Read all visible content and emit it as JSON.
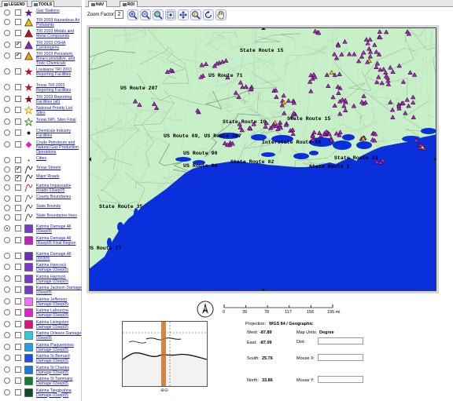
{
  "left_tabs": [
    "LEGEND",
    "TOOLS"
  ],
  "map_tabs": [
    "NAV",
    "ROI"
  ],
  "layers": [
    {
      "label": "Gas Stations",
      "radio": false,
      "checked": false,
      "symbol": "star",
      "color": "#5a1aa0"
    },
    {
      "label": "TRI 2003 Hazardous Air Pollutants",
      "radio": false,
      "checked": false,
      "symbol": "triangle",
      "color": "#f2c200"
    },
    {
      "label": "TRI 2003 Metals and Metal Compounds",
      "radio": false,
      "checked": false,
      "symbol": "triangle",
      "color": "#c0102a"
    },
    {
      "label": "TRI 2003 OSHA Carcinogens",
      "radio": false,
      "checked": true,
      "symbol": "triangle",
      "color": "#9a23c8"
    },
    {
      "label": "TRI 2003 Persistent, Bioaccumulative, and Toxic Chemicals",
      "radio": false,
      "checked": true,
      "symbol": "triangle",
      "color": "#f2a800"
    },
    {
      "label": "Louisiana TRI 2003 Reporting Facilities",
      "radio": false,
      "checked": false,
      "symbol": "star",
      "color": "#c0102a"
    },
    {
      "label": "Texas TRI 2003 Reporting Facilities",
      "radio": false,
      "checked": false,
      "symbol": "star",
      "color": "#c0102a"
    },
    {
      "label": "TRI 2003 Reporting Facilities (all)",
      "radio": false,
      "checked": false,
      "symbol": "star",
      "color": "#8a0a1a"
    },
    {
      "label": "National Priority List Sites",
      "radio": false,
      "checked": false,
      "symbol": "star-outline",
      "color": "#b8a000"
    },
    {
      "label": "Texas NPL Sites Final",
      "radio": false,
      "checked": false,
      "symbol": "star-outline",
      "color": "#2a7a2a"
    },
    {
      "label": "Chemicals Industry Facilities",
      "radio": false,
      "checked": false,
      "symbol": "dot",
      "color": "#202020"
    },
    {
      "label": "Crude Petroleum and Natural Gas Production Operations",
      "radio": false,
      "checked": false,
      "symbol": "diamond",
      "color": "#e020c0"
    },
    {
      "label": "Cities",
      "radio": false,
      "checked": false,
      "symbol": "smalldot",
      "color": "#444444"
    },
    {
      "label": "Texas Streets",
      "radio": false,
      "checked": true,
      "symbol": "line",
      "color": "#202020"
    },
    {
      "label": "Major Roads",
      "radio": false,
      "checked": true,
      "symbol": "line",
      "color": "#202020"
    },
    {
      "label": "Katrina Impassable Roads 03sep05",
      "radio": false,
      "checked": false,
      "symbol": "line",
      "color": "#c02020"
    },
    {
      "label": "County Boundaries",
      "radio": false,
      "checked": false,
      "symbol": "line",
      "color": "#606060"
    },
    {
      "label": "State Bounds",
      "radio": false,
      "checked": false,
      "symbol": "line",
      "color": "#404040"
    },
    {
      "label": "State Boundaries lines",
      "radio": false,
      "checked": false,
      "symbol": "line",
      "color": "#404040"
    },
    {
      "label": "Katrina Damage All 03sep05",
      "radio": true,
      "checked": false,
      "symbol": "square",
      "color": "#7a3ac8"
    },
    {
      "label": "Katrina Damage All 06sep05 Final Region",
      "radio": false,
      "checked": false,
      "symbol": "square",
      "color": "#c020c0"
    },
    {
      "label": "Katrina Damage All 090305",
      "radio": false,
      "checked": false,
      "symbol": "square",
      "color": "#6a30b8"
    },
    {
      "label": "Katrina Hancock Damage 03sep05",
      "radio": false,
      "checked": false,
      "symbol": "square",
      "color": "#7a3ac8"
    },
    {
      "label": "Katrina Harrison Damage 03sep05",
      "radio": false,
      "checked": false,
      "symbol": "square",
      "color": "#7a3ac8"
    },
    {
      "label": "Katrina Jackson Damage 03sep05",
      "radio": false,
      "checked": false,
      "symbol": "square",
      "color": "#7a3ac8"
    },
    {
      "label": "Katrina Jefferson Damage 03sep05",
      "radio": false,
      "checked": false,
      "symbol": "square",
      "color": "#f070f0"
    },
    {
      "label": "Katrina Lafourche Damage 03sep05",
      "radio": false,
      "checked": false,
      "symbol": "square",
      "color": "#e020c8"
    },
    {
      "label": "Katrina Livingston Damage 03sep05",
      "radio": false,
      "checked": false,
      "symbol": "square",
      "color": "#e0107a"
    },
    {
      "label": "Katrina Orleans Damage 03sep05",
      "radio": false,
      "checked": false,
      "symbol": "square",
      "color": "#30c8e0"
    },
    {
      "label": "Katrina Plaquemines Damage 03sep05",
      "radio": false,
      "checked": false,
      "symbol": "square",
      "color": "#20a0e0"
    },
    {
      "label": "Katrina St Bernard Damage 03sep05",
      "radio": false,
      "checked": false,
      "symbol": "square",
      "color": "#2050e0"
    },
    {
      "label": "Katrina St Charles Damage 03sep05",
      "radio": false,
      "checked": false,
      "symbol": "square",
      "color": "#1a7ad0"
    },
    {
      "label": "Katrina St Tammany Damage 03sep05",
      "radio": false,
      "checked": false,
      "symbol": "square",
      "color": "#1a7a3a"
    },
    {
      "label": "Katrina Tangipahoa Damage 03sep05",
      "radio": false,
      "checked": false,
      "symbol": "square",
      "color": "#104a2a"
    }
  ],
  "toolbar": {
    "zoom_label": "Zoom Factor:",
    "zoom_value": "2",
    "tools": [
      "zoom-in",
      "zoom-out",
      "zoom-full",
      "zoom-extent",
      "pan",
      "identify",
      "refresh",
      "hand"
    ]
  },
  "map": {
    "route_labels": [
      "State Route 15",
      "US Route 71",
      "US Route 287",
      "State Route 10",
      "State Route 15",
      "US Route 69, US Route 287",
      "Interstate Route 10",
      "US Route 90",
      "US Route 96",
      "State Route 82",
      "State Route 23",
      "State Route 1",
      "State Route 35",
      "US Route 77"
    ],
    "land_color": "#c8f0c8",
    "water_color": "#0a2fdc",
    "facility_color": "#b020c8"
  },
  "scale_bar": {
    "ticks": [
      "0",
      "39",
      "78",
      "117",
      "156",
      "195 mi"
    ]
  },
  "info": {
    "projection_label": "Projection:",
    "projection_value": "WGS 84 / Geographic",
    "map_units_label": "Map Units:",
    "map_units_value": "Degree",
    "west_label": "West:",
    "west_value": "-87.89",
    "east_label": "East:",
    "east_value": "-87.09",
    "south_label": "South:",
    "south_value": "25.76",
    "north_label": "North:",
    "north_value": "33.86",
    "dist_label": "Dist:",
    "mouse_x_label": "Mouse X:",
    "mouse_y_label": "Mouse Y:"
  },
  "north_symbol": "N"
}
